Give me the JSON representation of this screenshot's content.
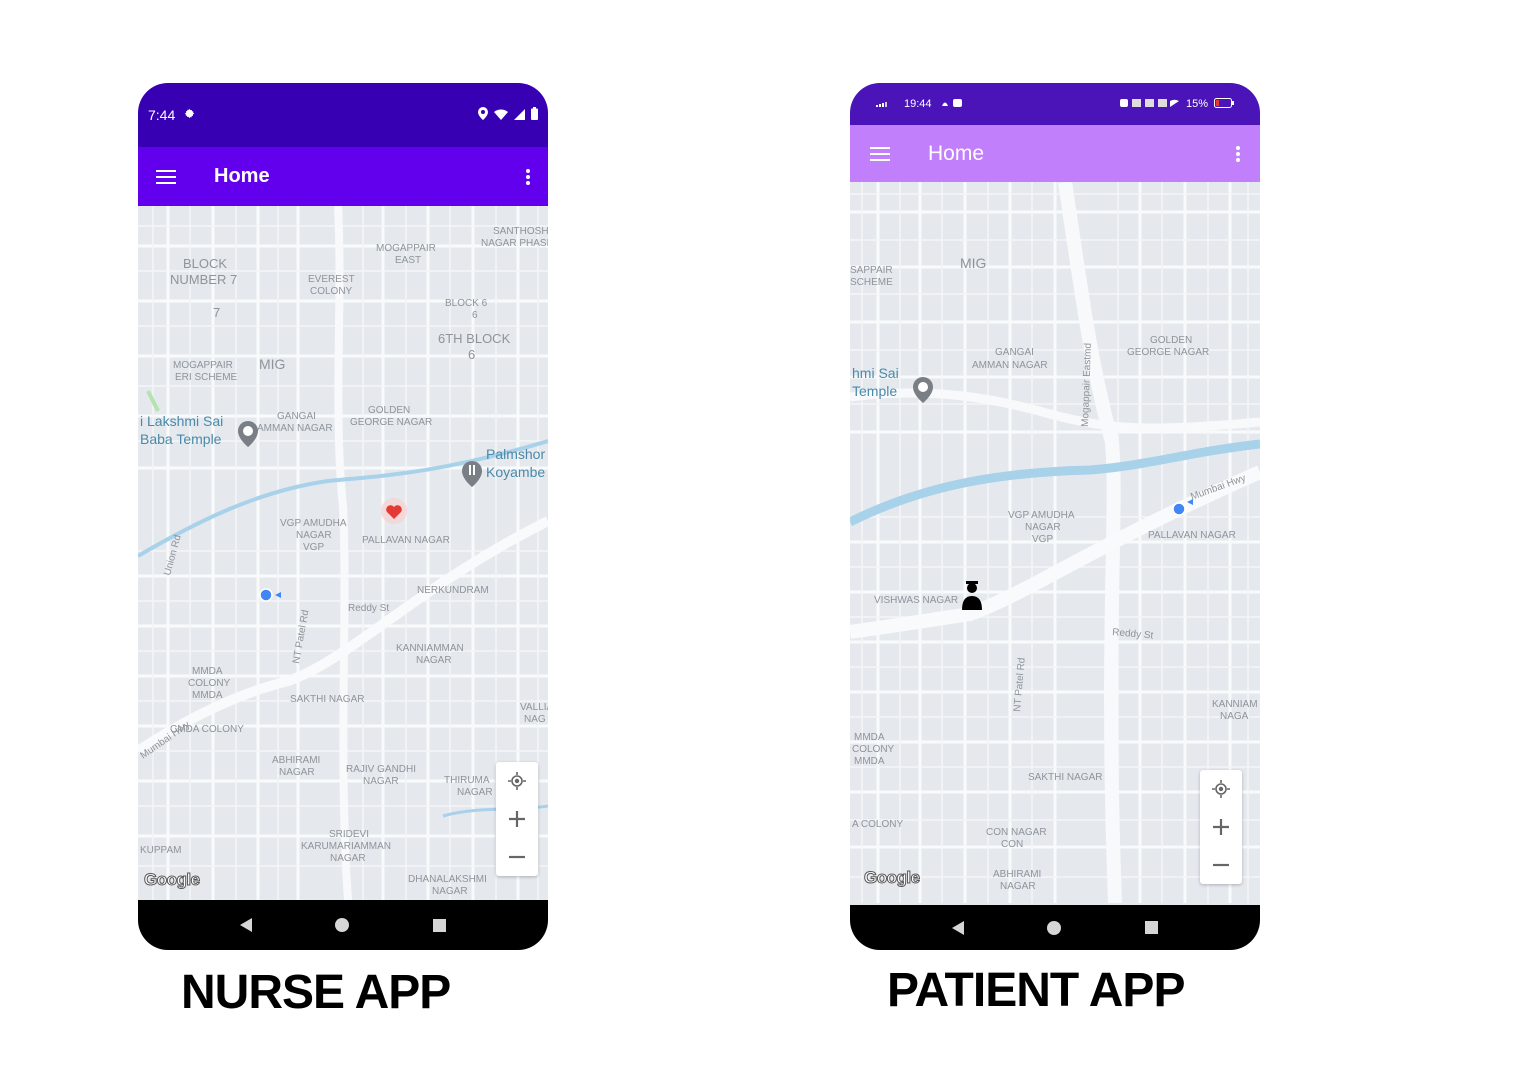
{
  "nurse": {
    "status_time": "7:44",
    "appbar_title": "Home",
    "caption": "NURSE APP",
    "map_labels": [
      "SANTHOSH",
      "NAGAR PHASE",
      "MOGAPPAIR",
      "EAST",
      "BLOCK",
      "NUMBER 7",
      "EVEREST",
      "COLONY",
      "BLOCK 6",
      "6",
      "6TH BLOCK",
      "6",
      "7",
      "MOGAPPAIR",
      "ERI SCHEME",
      "MIG",
      "GANGAI",
      "AMMAN NAGAR",
      "GOLDEN",
      "GEORGE NAGAR",
      "i Lakshmi Sai",
      "Baba Temple",
      "Palmshor",
      "Koyambe",
      "VGP AMUDHA",
      "NAGAR",
      "VGP",
      "PALLAVAN NAGAR",
      "NERKUNDRAM",
      "Union Rd",
      "Reddy St",
      "Mumbai Hwy",
      "NT Patel Rd",
      "KANNIAMMAN",
      "NAGAR",
      "VALLIA",
      "NAG",
      "MMDA",
      "COLONY",
      "MMDA",
      "SAKTHI NAGAR",
      "CMDA COLONY",
      "ABHIRAMI",
      "NAGAR",
      "RAJIV GANDHI",
      "NAGAR",
      "THIRUMA",
      "NAGAR",
      "SRIDEVI",
      "KARUMARIAMMAN",
      "NAGAR",
      "KUPPAM",
      "DHANALAKSHMI",
      "NAGAR"
    ],
    "google_logo": "Google"
  },
  "patient": {
    "status_time": "19:44",
    "status_battery": "15%",
    "appbar_title": "Home",
    "caption": "PATIENT APP",
    "map_labels": [
      "SAPPAIR",
      "SCHEME",
      "MIG",
      "GANGAI",
      "AMMAN NAGAR",
      "Mogappair Eastmd",
      "GOLDEN",
      "GEORGE NAGAR",
      "hmi Sai",
      "Temple",
      "Mumbai Hwy",
      "VGP AMUDHA",
      "NAGAR",
      "VGP",
      "PALLAVAN NAGAR",
      "VISHWAS NAGAR",
      "Reddy St",
      "NT Patel Rd",
      "KANNIAM",
      "NAGA",
      "MMDA",
      "COLONY",
      "MMDA",
      "SAKTHI NAGAR",
      "A COLONY",
      "CON NAGAR",
      "CON",
      "ABHIRAMI",
      "NAGAR"
    ],
    "google_logo": "Google"
  },
  "colors": {
    "nurse_status": "#3700b3",
    "nurse_appbar": "#6200ee",
    "patient_status": "#4a14b8",
    "patient_appbar": "#c17ffc",
    "map_bg": "#e5e9ee",
    "river": "#a8d1ea",
    "marker_blue": "#4285f4",
    "marker_heart": "#e53935"
  },
  "icons": [
    "settings-icon",
    "location-icon",
    "wifi-icon",
    "signal-icon",
    "battery-icon",
    "menu-icon",
    "more-vert-icon",
    "heart-marker-icon",
    "nurse-marker-icon",
    "temple-pin-icon",
    "restaurant-pin-icon",
    "my-location-icon",
    "zoom-in-icon",
    "zoom-out-icon",
    "back-icon",
    "home-icon",
    "recents-icon"
  ]
}
